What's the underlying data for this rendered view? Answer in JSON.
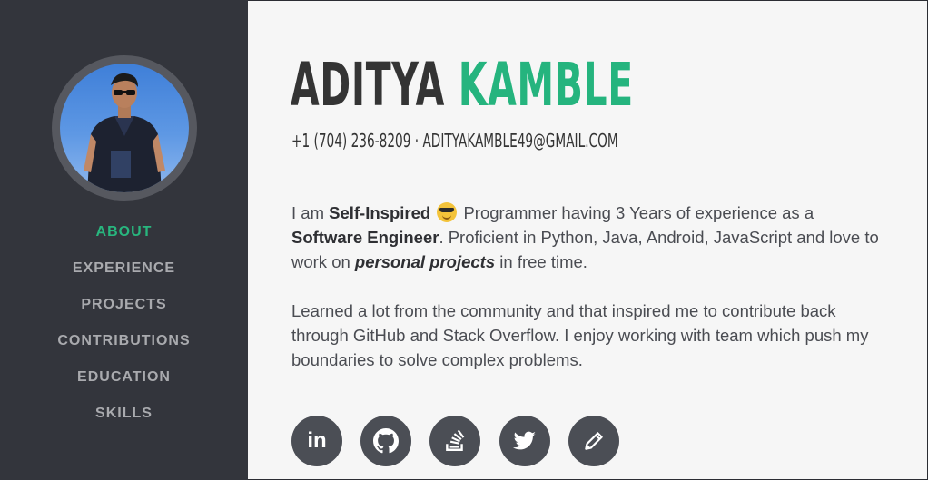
{
  "profile": {
    "first_name": "ADITYA",
    "last_name": "KAMBLE",
    "contact": "+1 (704) 236-8209 · ADITYAKAMBLE49@GMAIL.COM"
  },
  "nav": {
    "items": [
      {
        "label": "ABOUT",
        "active": true
      },
      {
        "label": "EXPERIENCE",
        "active": false
      },
      {
        "label": "PROJECTS",
        "active": false
      },
      {
        "label": "CONTRIBUTIONS",
        "active": false
      },
      {
        "label": "EDUCATION",
        "active": false
      },
      {
        "label": "SKILLS",
        "active": false
      }
    ]
  },
  "about": {
    "p1_a": "I am ",
    "p1_b": "Self-Inspired",
    "p1_c": " Programmer having 3 Years of experience as a ",
    "p1_d": "Software Engineer",
    "p1_e": ". Proficient in Python, Java, Android, JavaScript and love to work on ",
    "p1_f": "personal projects",
    "p1_g": " in free time.",
    "p2": "Learned a lot from the community and that inspired me to contribute back through GitHub and Stack Overflow. I enjoy working with team which push my boundaries to solve complex problems."
  },
  "social": {
    "linkedin_label": "in",
    "icons": [
      "linkedin-icon",
      "github-icon",
      "stackoverflow-icon",
      "twitter-icon",
      "pencil-icon"
    ]
  },
  "colors": {
    "sidebar_bg": "#33353c",
    "accent": "#25b47e",
    "nav_text": "#a9aaae",
    "social_bg": "#4b4e55"
  }
}
